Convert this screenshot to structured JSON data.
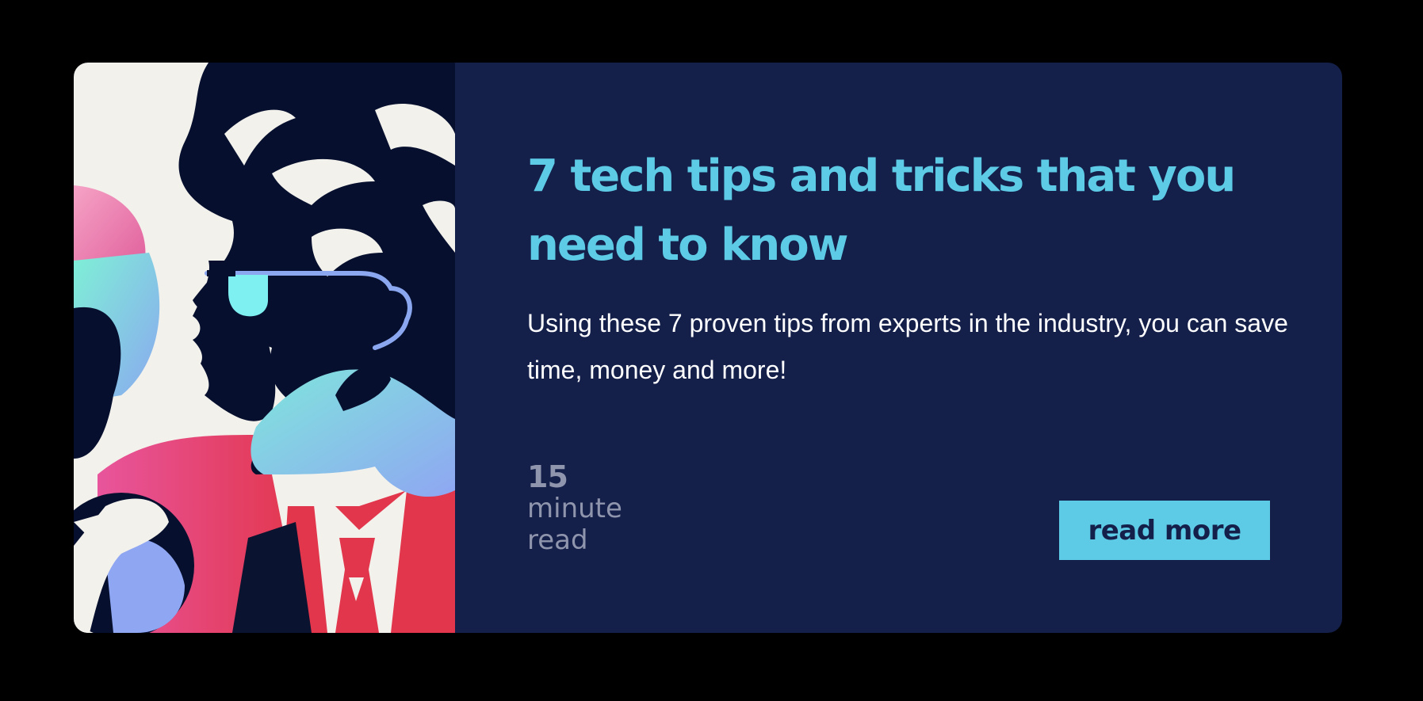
{
  "card": {
    "title": "7 tech tips and tricks that you need to know",
    "description": "Using these 7 proven tips from experts in the industry, you can save time, money and more!",
    "read_time": {
      "number": "15",
      "unit_line1": "minute",
      "unit_line2": "read"
    },
    "cta_label": "read more"
  },
  "colors": {
    "page_background": "#000000",
    "card_background": "#141f4a",
    "accent": "#5ecbe6",
    "muted_text": "#8f95ad",
    "body_text": "#ffffff"
  },
  "illustration": {
    "icon": "person-with-sunglasses-illustration"
  }
}
